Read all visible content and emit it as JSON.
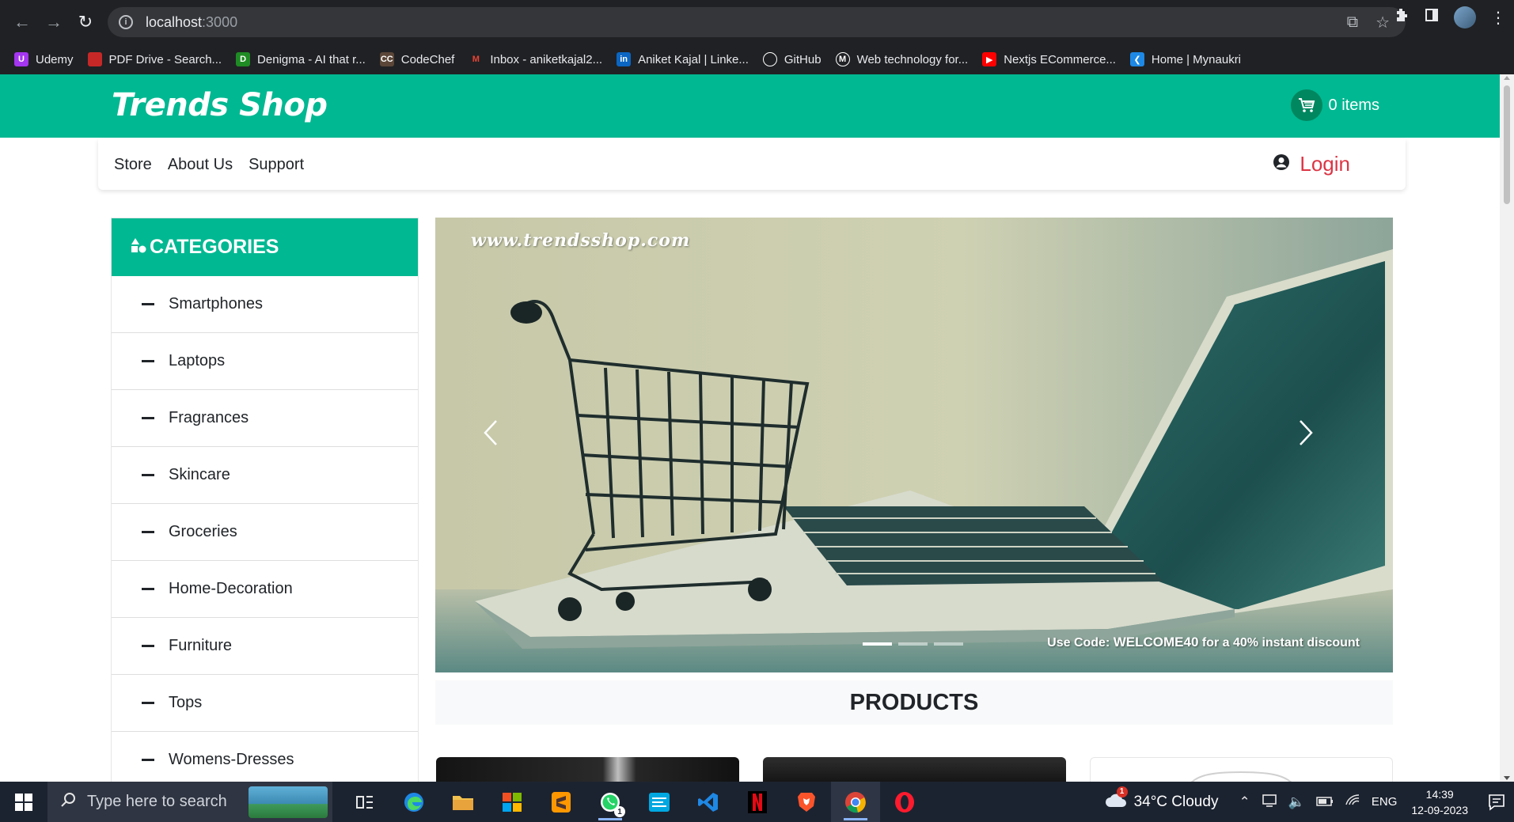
{
  "browser": {
    "url_host": "localhost",
    "url_port": ":3000",
    "bookmarks": [
      {
        "label": "Udemy",
        "color": "#a435f0"
      },
      {
        "label": "PDF Drive - Search...",
        "color": "#c62828"
      },
      {
        "label": "Denigma - AI that r...",
        "color": "#1f8b24"
      },
      {
        "label": "CodeChef",
        "color": "#5b4638"
      },
      {
        "label": "Inbox - aniketkajal2...",
        "color": "#ea4335"
      },
      {
        "label": "Aniket Kajal | Linke...",
        "color": "#0a66c2"
      },
      {
        "label": "GitHub",
        "color": "#ffffff"
      },
      {
        "label": "Web technology for...",
        "color": "#ffffff"
      },
      {
        "label": "Nextjs ECommerce...",
        "color": "#ff0000"
      },
      {
        "label": "Home | Mynaukri",
        "color": "#1e88e5"
      }
    ]
  },
  "site": {
    "brand": "Trends Shop",
    "cart_label": "0 items",
    "nav": [
      "Store",
      "About Us",
      "Support"
    ],
    "login_label": "Login",
    "accent": "#00b892",
    "login_color": "#dc3545"
  },
  "categories": {
    "title": "CATEGORIES",
    "items": [
      "Smartphones",
      "Laptops",
      "Fragrances",
      "Skincare",
      "Groceries",
      "Home-Decoration",
      "Furniture",
      "Tops",
      "Womens-Dresses"
    ]
  },
  "carousel": {
    "watermark": "www.trendsshop.com",
    "promo_prefix": "Use Code: ",
    "promo_code": "WELCOME40",
    "promo_suffix": " for a 40% instant discount",
    "slide_count": 3,
    "active_slide": 1
  },
  "products": {
    "heading": "PRODUCTS"
  },
  "taskbar": {
    "search_placeholder": "Type here to search",
    "whatsapp_badge": "1",
    "weather_badge": "1",
    "weather": "34°C  Cloudy",
    "lang": "ENG",
    "time": "14:39",
    "date": "12-09-2023"
  }
}
